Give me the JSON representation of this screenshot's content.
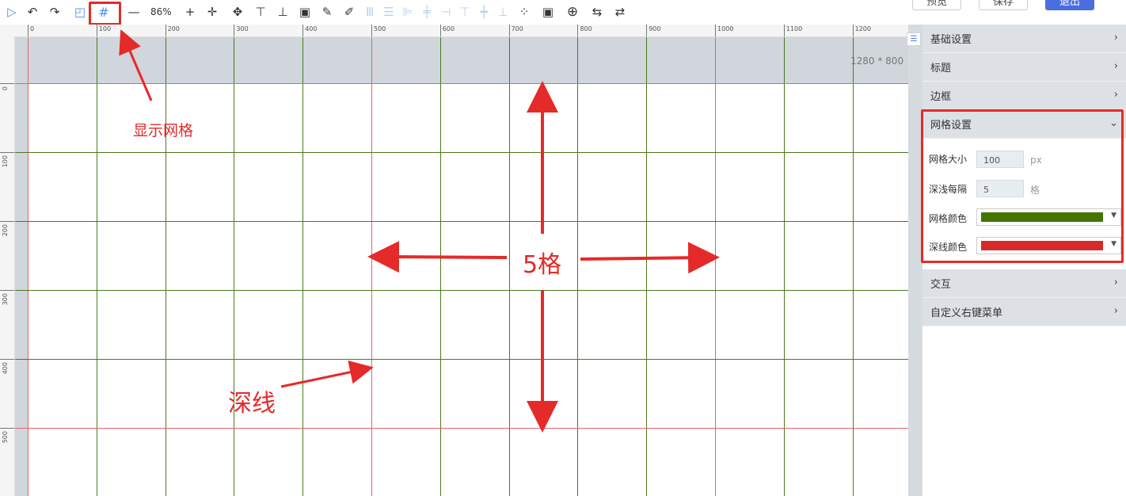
{
  "toolbar": {
    "zoom_label": "86%",
    "buttons": [
      "select-icon",
      "undo-icon",
      "redo-icon",
      "frame-icon",
      "grid-icon",
      "zoom-out-icon",
      "zoom-in-icon",
      "fit-icon",
      "move-icon",
      "align-top-icon",
      "align-middle-icon",
      "group-icon",
      "format-painter-icon",
      "brush-icon",
      "distribute-h-icon",
      "distribute-v-icon",
      "align-left-icon",
      "align-center-icon",
      "align-right-icon",
      "align-top2-icon",
      "align-vcenter-icon",
      "align-bottom-icon",
      "snap-icon",
      "fullscreen-icon",
      "target-icon",
      "swap-icon",
      "flow-icon"
    ],
    "preview_label": "预览",
    "save_label": "保存",
    "exit_label": "退出"
  },
  "ruler": {
    "top_ticks": [
      "0",
      "100",
      "200",
      "300",
      "400",
      "500",
      "600",
      "700",
      "800",
      "900",
      "1000",
      "1100",
      "1200"
    ],
    "left_ticks": [
      "0",
      "100",
      "200",
      "300",
      "400",
      "500"
    ]
  },
  "canvas": {
    "size_label": "1280 * 800",
    "grid_color": "#4a7a1e",
    "deep_line_color": "#e06666"
  },
  "panel": {
    "sections_top": [
      "基础设置",
      "标题",
      "边框"
    ],
    "grid_section": {
      "title": "网格设置",
      "grid_size_label": "网格大小",
      "grid_size_value": "100",
      "grid_size_unit": "px",
      "deep_every_label": "深浅每隔",
      "deep_every_value": "5",
      "deep_every_unit": "格",
      "grid_color_label": "网格颜色",
      "grid_color_value": "#457500",
      "deep_color_label": "深线颜色",
      "deep_color_value": "#d62b2b"
    },
    "sections_bottom": [
      "交互",
      "自定义右键菜单"
    ]
  },
  "annotations": {
    "show_grid": "显示网格",
    "five_cells": "5格",
    "deep_line": "深线"
  }
}
